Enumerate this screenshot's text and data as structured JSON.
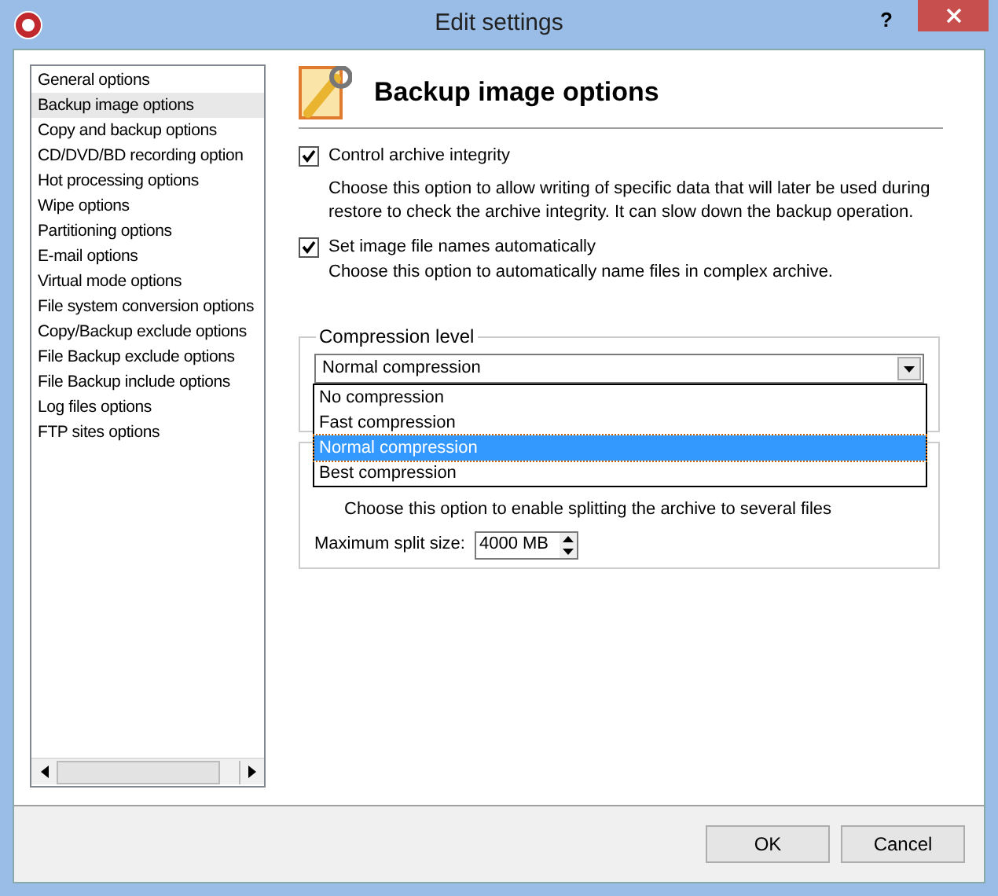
{
  "window": {
    "title": "Edit settings",
    "help": "?"
  },
  "sidebar": {
    "items": [
      {
        "label": "General options",
        "selected": false
      },
      {
        "label": "Backup image options",
        "selected": true
      },
      {
        "label": "Copy and backup options",
        "selected": false
      },
      {
        "label": "CD/DVD/BD recording option",
        "selected": false
      },
      {
        "label": "Hot processing options",
        "selected": false
      },
      {
        "label": "Wipe options",
        "selected": false
      },
      {
        "label": "Partitioning options",
        "selected": false
      },
      {
        "label": "E-mail options",
        "selected": false
      },
      {
        "label": "Virtual mode options",
        "selected": false
      },
      {
        "label": "File system conversion options",
        "selected": false
      },
      {
        "label": "Copy/Backup exclude options",
        "selected": false
      },
      {
        "label": "File Backup exclude options",
        "selected": false
      },
      {
        "label": "File Backup include options",
        "selected": false
      },
      {
        "label": "Log files options",
        "selected": false
      },
      {
        "label": "FTP sites options",
        "selected": false
      }
    ]
  },
  "panel": {
    "title": "Backup image options",
    "options": [
      {
        "label": "Control archive integrity",
        "checked": true,
        "description": "Choose this option to allow writing of specific data that will later be used during restore to check the archive integrity. It can slow down the backup operation."
      },
      {
        "label": "Set image file names automatically",
        "checked": true,
        "description": "Choose this option to automatically name files in complex archive."
      }
    ],
    "compression": {
      "legend": "Compression level",
      "value": "Normal compression",
      "expanded": true,
      "options": [
        {
          "label": "No compression",
          "selected": false
        },
        {
          "label": "Fast compression",
          "selected": false
        },
        {
          "label": "Normal compression",
          "selected": true
        },
        {
          "label": "Best compression",
          "selected": false
        }
      ]
    },
    "splitting": {
      "description": "Choose this option to enable splitting the archive to several files",
      "size_label": "Maximum split size:",
      "size_value": "4000 MB"
    }
  },
  "buttons": [
    "OK",
    "Cancel"
  ]
}
